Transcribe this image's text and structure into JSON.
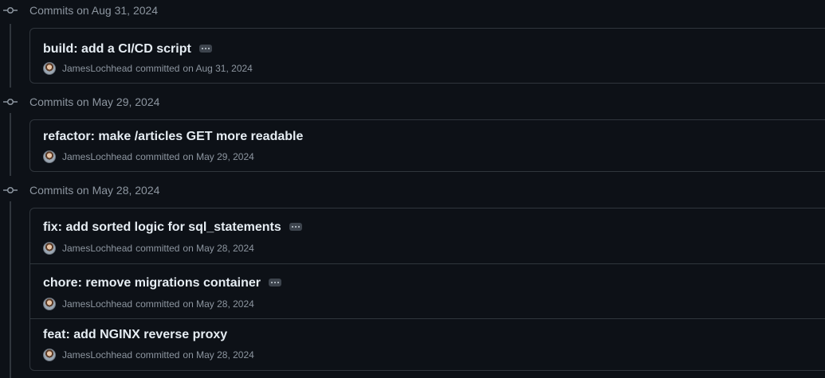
{
  "groups": [
    {
      "title": "Commits on Aug 31, 2024",
      "commits": [
        {
          "message": "build: add a CI/CD script",
          "author": "JamesLochhead",
          "action": "committed",
          "date": "on Aug 31, 2024",
          "has_more": true
        }
      ]
    },
    {
      "title": "Commits on May 29, 2024",
      "commits": [
        {
          "message": "refactor: make /articles GET more readable",
          "author": "JamesLochhead",
          "action": "committed",
          "date": "on May 29, 2024",
          "has_more": false
        }
      ]
    },
    {
      "title": "Commits on May 28, 2024",
      "commits": [
        {
          "message": "fix: add sorted logic for sql_statements",
          "author": "JamesLochhead",
          "action": "committed",
          "date": "on May 28, 2024",
          "has_more": true
        },
        {
          "message": "chore: remove migrations container",
          "author": "JamesLochhead",
          "action": "committed",
          "date": "on May 28, 2024",
          "has_more": true
        },
        {
          "message": "feat: add NGINX reverse proxy",
          "author": "JamesLochhead",
          "action": "committed",
          "date": "on May 28, 2024",
          "has_more": false
        }
      ]
    }
  ],
  "colors": {
    "background": "#0d1117",
    "border": "#30363d",
    "text_primary": "#e6edf3",
    "text_muted": "#8d96a0"
  },
  "icons": {
    "group_marker": "git-commit-icon",
    "more": "ellipsis-icon",
    "user": "avatar"
  }
}
